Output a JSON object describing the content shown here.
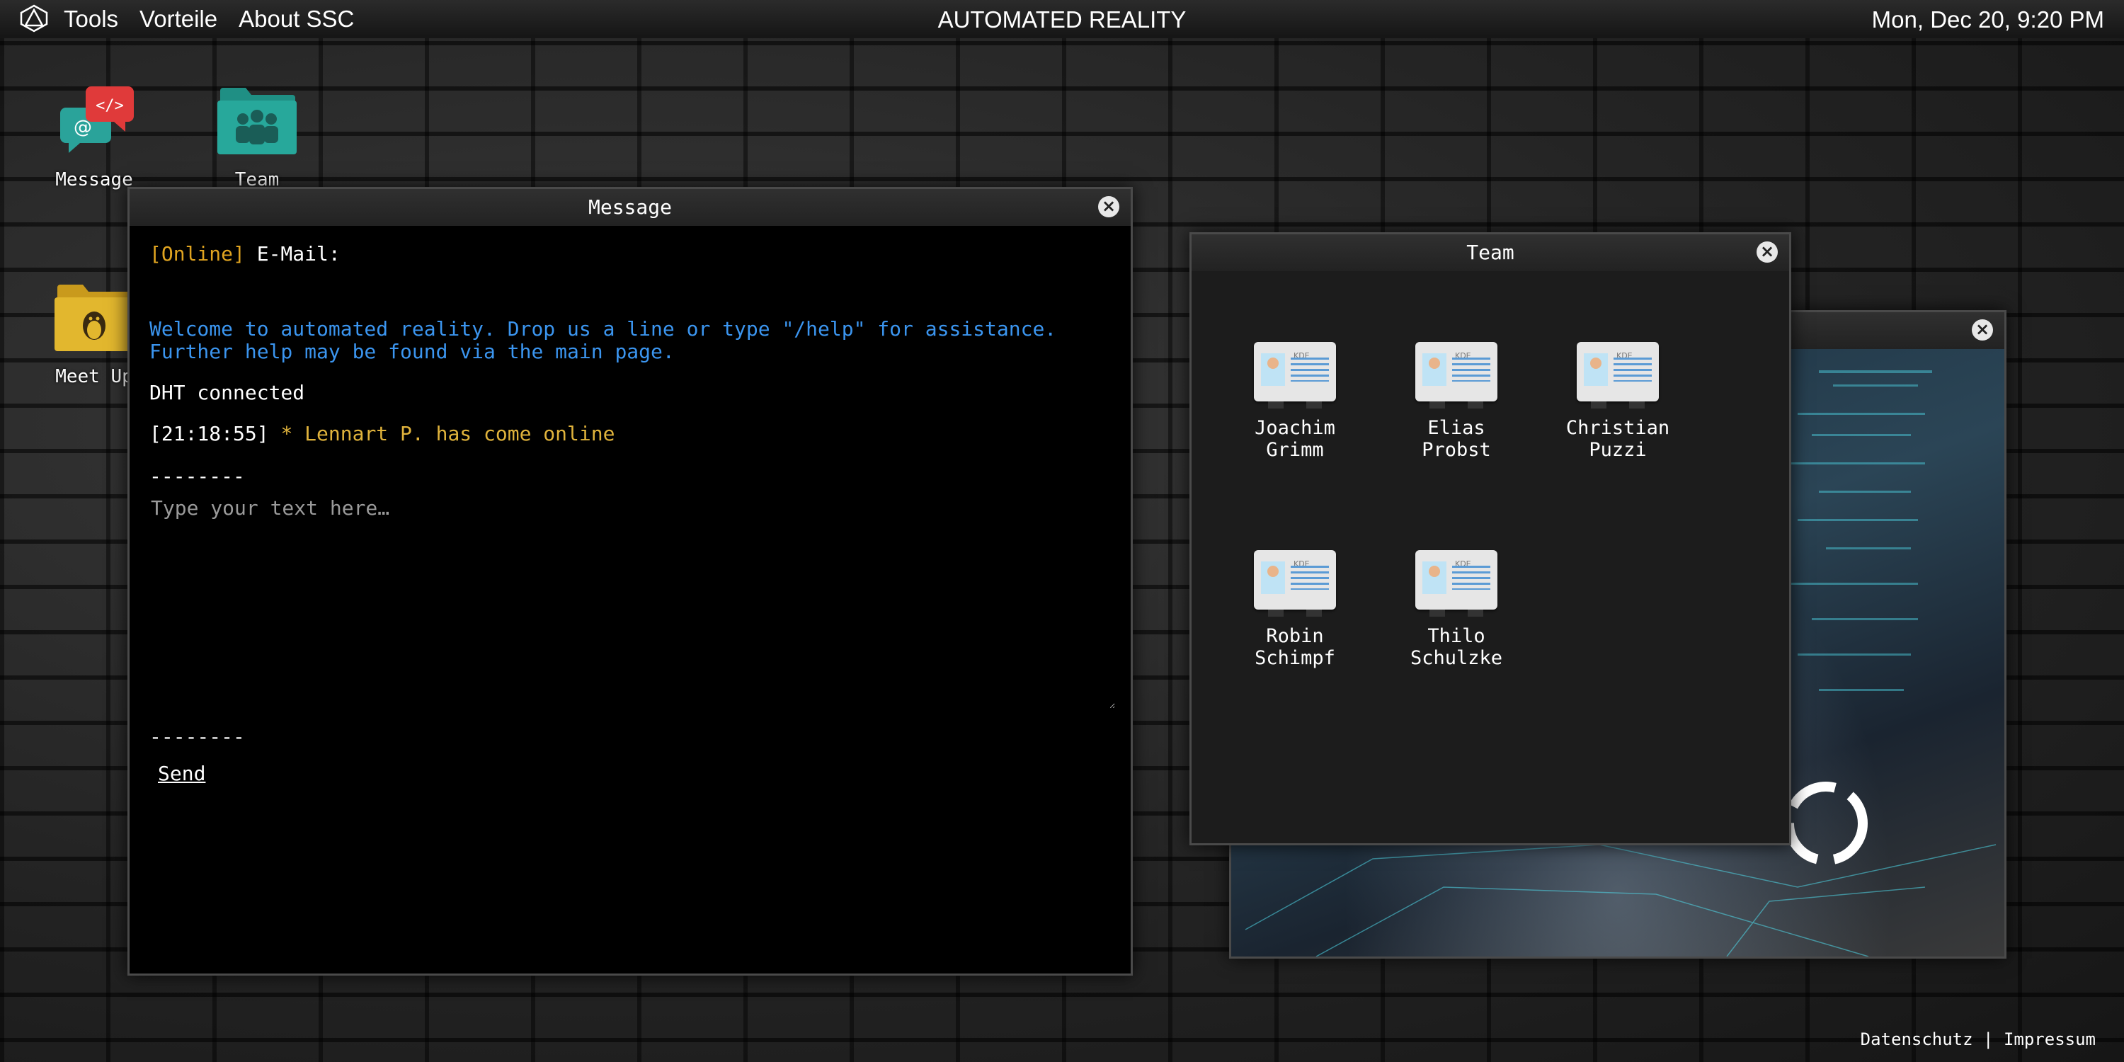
{
  "topbar": {
    "menu": [
      "Tools",
      "Vorteile",
      "About SSC"
    ],
    "title": "AUTOMATED REALITY",
    "clock": "Mon, Dec 20, 9:20 PM"
  },
  "desktop_icons": [
    {
      "label": "Message",
      "icon": "chat-code-icon"
    },
    {
      "label": "Team",
      "icon": "team-folder-icon"
    },
    {
      "label": "Meet Up",
      "icon": "penguin-folder-icon"
    }
  ],
  "message_window": {
    "title": "Message",
    "status": "[Online]",
    "email_label": "E-Mail:",
    "welcome": "Welcome to automated reality. Drop us a line or type \"/help\" for assistance. Further help may be found via the main page.",
    "dht": "DHT connected",
    "log_time": "[21:18:55]",
    "log_text": "* Lennart P. has come online",
    "separator": "--------",
    "input_placeholder": "Type your text here…",
    "send_label": "Send"
  },
  "team_window": {
    "title": "Team",
    "members": [
      {
        "first": "Joachim",
        "last": "Grimm"
      },
      {
        "first": "Elias",
        "last": "Probst"
      },
      {
        "first": "Christian",
        "last": "Puzzi"
      },
      {
        "first": "Robin",
        "last": "Schimpf"
      },
      {
        "first": "Thilo",
        "last": "Schulzke"
      }
    ],
    "card_badge": "KDE"
  },
  "footer": {
    "privacy": "Datenschutz",
    "divider": "|",
    "imprint": "Impressum"
  },
  "colors": {
    "online": "#e0a420",
    "info_blue": "#3b95ef",
    "event_yellow": "#e0b33c"
  }
}
